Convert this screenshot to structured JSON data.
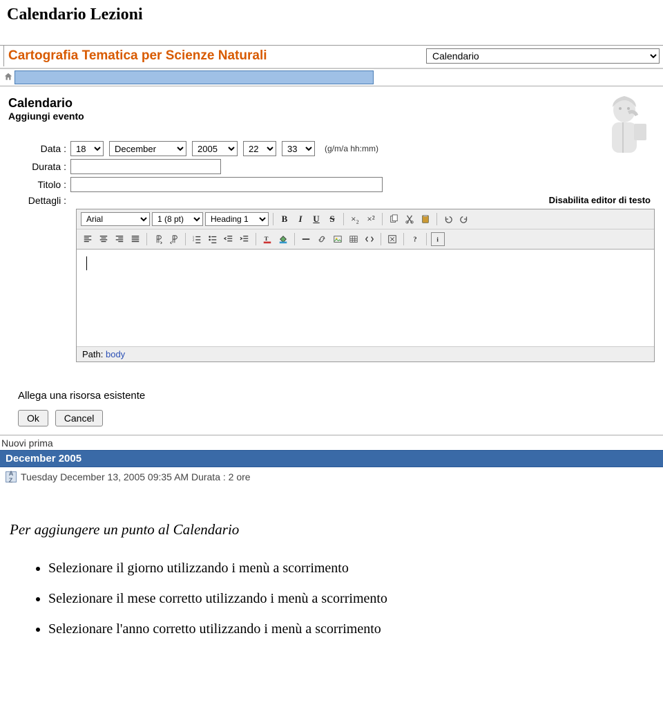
{
  "page": {
    "title": "Calendario Lezioni"
  },
  "header": {
    "course_title": "Cartografia Tematica per Scienze Naturali",
    "nav_select": "Calendario"
  },
  "section": {
    "title": "Calendario",
    "subtitle": "Aggiungi evento"
  },
  "form": {
    "data_label": "Data :",
    "data_day": "18",
    "data_month": "December",
    "data_year": "2005",
    "data_hh": "22",
    "data_mm": "33",
    "data_hint": "(g/m/a hh:mm)",
    "durata_label": "Durata :",
    "durata_value": "",
    "titolo_label": "Titolo :",
    "titolo_value": "",
    "dettagli_label": "Dettagli :",
    "disable_editor": "Disabilita editor di testo"
  },
  "editor": {
    "font": "Arial",
    "size": "1 (8 pt)",
    "heading": "Heading 1",
    "path_label": "Path:",
    "path_value": "body"
  },
  "toolbar_labels": {
    "bold": "B",
    "italic": "I",
    "underline": "U",
    "strike": "S",
    "sub": "×₂",
    "sup": "×²"
  },
  "actions": {
    "attach_link": "Allega una risorsa esistente",
    "ok": "Ok",
    "cancel": "Cancel"
  },
  "list": {
    "nuovi": "Nuovi prima",
    "month_header": "December 2005",
    "event_text": "Tuesday December 13, 2005 09:35 AM Durata : 2 ore"
  },
  "instructions": {
    "intro": "Per aggiungere un punto al Calendario",
    "items": [
      "Selezionare il giorno utilizzando i menù a scorrimento",
      "Selezionare il mese corretto utilizzando i menù a scorrimento",
      "Selezionare l'anno corretto utilizzando i menù a scorrimento"
    ]
  }
}
